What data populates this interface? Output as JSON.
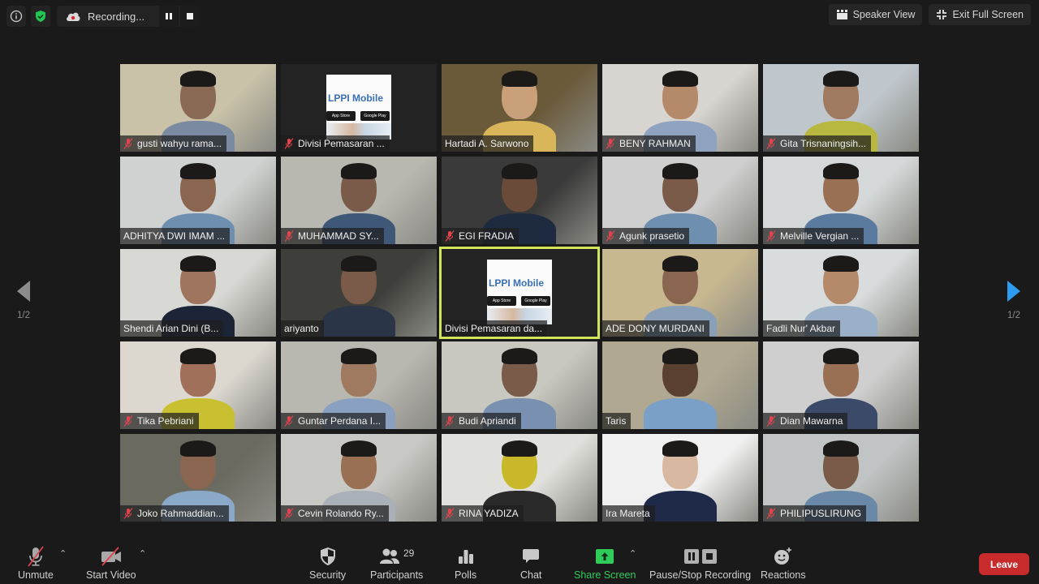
{
  "top_left": {
    "info_icon": "info-icon",
    "security_badge_icon": "shield-check-icon",
    "recording": {
      "icon": "cloud-recording-icon",
      "label": "Recording...",
      "pause_icon": "pause-icon",
      "stop_icon": "stop-icon"
    }
  },
  "top_right": {
    "speaker_view_label": "Speaker View",
    "exit_full_screen_label": "Exit Full Screen"
  },
  "pagination": {
    "prev_label": "1/2",
    "next_label": "1/2"
  },
  "participants": [
    {
      "name": "gusti wahyu rama...",
      "muted": true,
      "type": "video"
    },
    {
      "name": "Divisi Pemasaran ...",
      "muted": true,
      "type": "logo"
    },
    {
      "name": "Hartadi A. Sarwono",
      "muted": false,
      "type": "video"
    },
    {
      "name": "BENY RAHMAN",
      "muted": true,
      "type": "video"
    },
    {
      "name": "Gita Trisnaningsih...",
      "muted": true,
      "type": "video"
    },
    {
      "name": "ADHITYA DWI IMAM ...",
      "muted": false,
      "type": "video"
    },
    {
      "name": "MUHAMMAD SY...",
      "muted": true,
      "type": "video"
    },
    {
      "name": "EGI FRADIA",
      "muted": true,
      "type": "video"
    },
    {
      "name": "Agunk prasetio",
      "muted": true,
      "type": "video"
    },
    {
      "name": "Melville Vergian ...",
      "muted": true,
      "type": "video"
    },
    {
      "name": "Shendi Arian Dini (B...",
      "muted": false,
      "type": "video"
    },
    {
      "name": "ariyanto",
      "muted": false,
      "type": "video"
    },
    {
      "name": "Divisi Pemasaran da...",
      "muted": false,
      "type": "logo",
      "active_speaker": true
    },
    {
      "name": "ADE DONY MURDANI",
      "muted": false,
      "type": "video"
    },
    {
      "name": "Fadli Nur' Akbar",
      "muted": false,
      "type": "video"
    },
    {
      "name": "Tika Pebriani",
      "muted": true,
      "type": "video"
    },
    {
      "name": "Guntar Perdana I...",
      "muted": true,
      "type": "video"
    },
    {
      "name": "Budi Apriandi",
      "muted": true,
      "type": "video"
    },
    {
      "name": "Taris",
      "muted": false,
      "type": "video"
    },
    {
      "name": "Dian Mawarna",
      "muted": true,
      "type": "video"
    },
    {
      "name": "Joko Rahmaddian...",
      "muted": true,
      "type": "video"
    },
    {
      "name": "Cevin Rolando Ry...",
      "muted": true,
      "type": "video"
    },
    {
      "name": "RINA YADIZA",
      "muted": true,
      "type": "video"
    },
    {
      "name": "Ira Mareta",
      "muted": false,
      "type": "video"
    },
    {
      "name": "PHILIPUSLIRUNG",
      "muted": true,
      "type": "video"
    }
  ],
  "logo_tile": {
    "title": "LPPI Mobile",
    "app_store": "App Store",
    "google_play": "Google Play"
  },
  "toolbar": {
    "unmute_label": "Unmute",
    "start_video_label": "Start Video",
    "security_label": "Security",
    "participants_label": "Participants",
    "participants_count": "29",
    "polls_label": "Polls",
    "chat_label": "Chat",
    "share_screen_label": "Share Screen",
    "pause_stop_recording_label": "Pause/Stop Recording",
    "reactions_label": "Reactions",
    "leave_label": "Leave"
  },
  "colors": {
    "share_green": "#2fcc59",
    "leave_red": "#c82b2b",
    "active_speaker": "#d2e55a",
    "nav_active": "#2d9bf0",
    "muted_red": "#e0454f"
  }
}
